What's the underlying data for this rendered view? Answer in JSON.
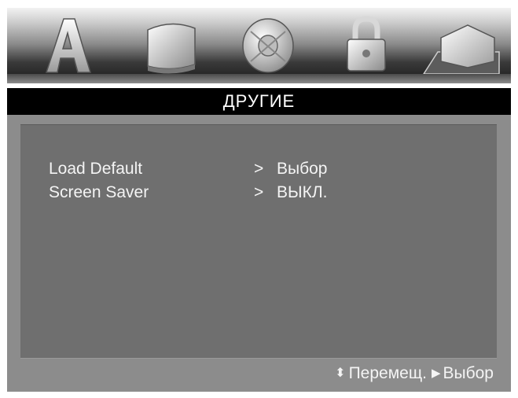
{
  "osd": {
    "tabs": [
      {
        "icon": "letter-a-icon",
        "active": false
      },
      {
        "icon": "picture-icon",
        "active": false
      },
      {
        "icon": "sound-dish-icon",
        "active": false
      },
      {
        "icon": "padlock-icon",
        "active": false
      },
      {
        "icon": "other-settings-icon",
        "active": true
      }
    ],
    "section_title": "ДРУГИЕ",
    "items": [
      {
        "label": "Load Default",
        "arrow": ">",
        "value": "Выбор"
      },
      {
        "label": "Screen Saver",
        "arrow": ">",
        "value": "ВЫКЛ."
      }
    ],
    "footer": {
      "move_glyph": "⬍",
      "move_label": "Перемещ.",
      "select_glyph": "▶",
      "select_label": "Выбор"
    },
    "colors": {
      "panel": "#8c8c8c",
      "content": "#6f6f6f",
      "title_band": "#000000",
      "text": "#f4f4f4"
    }
  }
}
